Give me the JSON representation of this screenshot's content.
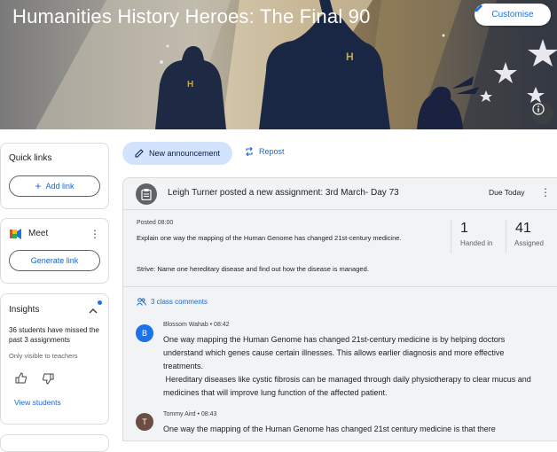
{
  "banner": {
    "title": "Humanities History Heroes: The Final 90",
    "customise_label": "Customise"
  },
  "sidebar": {
    "quick_links": {
      "title": "Quick links",
      "add_link_label": "Add link"
    },
    "meet": {
      "title": "Meet",
      "generate_link_label": "Generate link"
    },
    "insights": {
      "title": "Insights",
      "message": "36 students have missed the past 3 assignments",
      "visibility_note": "Only visible to teachers",
      "view_students_label": "View students"
    }
  },
  "actions": {
    "new_announcement_label": "New announcement",
    "repost_label": "Repost"
  },
  "post": {
    "title": "Leigh Turner posted a new assignment: 3rd March- Day 73",
    "due": "Due Today",
    "posted": "Posted 08:00",
    "instructions": "Explain one way the mapping of the Human Genome has changed 21st-century medicine.",
    "strive": "Strive: Name one hereditary disease and find out how the disease is managed.",
    "stats": [
      {
        "value": "1",
        "label": "Handed in"
      },
      {
        "value": "41",
        "label": "Assigned"
      }
    ],
    "comments_link": "3 class comments",
    "comments": [
      {
        "initial": "B",
        "meta": "Blossom Wahab • 08:42",
        "text": "One way mapping the Human Genome has changed 21st-century medicine is by helping doctors understand which genes cause certain illnesses. This allows earlier diagnosis and more effective treatments.",
        "text2": " Hereditary diseases like cystic fibrosis can be managed through daily physiotherapy to clear mucus and medicines that will improve lung function of the affected patient.",
        "color": "#1a73e8"
      },
      {
        "initial": "T",
        "meta": "Tommy Aird • 08:43",
        "text": "One way the mapping of the Human Genome has changed 21st century medicine is that there",
        "color": "#6d4c41"
      }
    ]
  },
  "colors": {
    "accent": "#1967d2",
    "button_fill": "#d3e3fd",
    "post_bg": "#f1f3f4"
  },
  "icons": [
    "pencil-icon",
    "info-icon",
    "plus-icon",
    "meet-icon",
    "more-vert-icon",
    "chevron-up-icon",
    "thumb-up-icon",
    "thumb-down-icon",
    "repost-icon",
    "assignment-icon",
    "people-icon"
  ]
}
